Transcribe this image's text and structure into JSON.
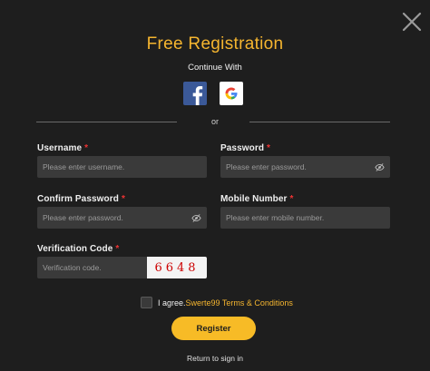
{
  "dialog": {
    "title": "Free Registration",
    "subtitle": "Continue With",
    "divider_text": "or",
    "social": [
      {
        "name": "facebook-icon",
        "color": "#3b5998"
      },
      {
        "name": "google-icon",
        "color": "#ffffff"
      }
    ]
  },
  "form": {
    "username": {
      "label": "Username",
      "placeholder": "Please enter username.",
      "value": ""
    },
    "password": {
      "label": "Password",
      "placeholder": "Please enter password.",
      "value": ""
    },
    "confirm_password": {
      "label": "Confirm Password",
      "placeholder": "Please enter password.",
      "value": ""
    },
    "mobile": {
      "label": "Mobile Number",
      "placeholder": "Please enter mobile number.",
      "value": ""
    },
    "verification": {
      "label": "Verification Code",
      "placeholder": "Verification code.",
      "value": "",
      "captcha": "6648"
    },
    "required_mark": "*"
  },
  "agreement": {
    "prefix": "I agree.",
    "link": "Swerte99 Terms & Conditions",
    "checked": false
  },
  "actions": {
    "register_label": "Register",
    "signin_label": "Return to sign in"
  },
  "colors": {
    "accent": "#f5b52f",
    "background": "#1e1e1e",
    "field": "#3a3a3a",
    "required": "#ee3333"
  }
}
